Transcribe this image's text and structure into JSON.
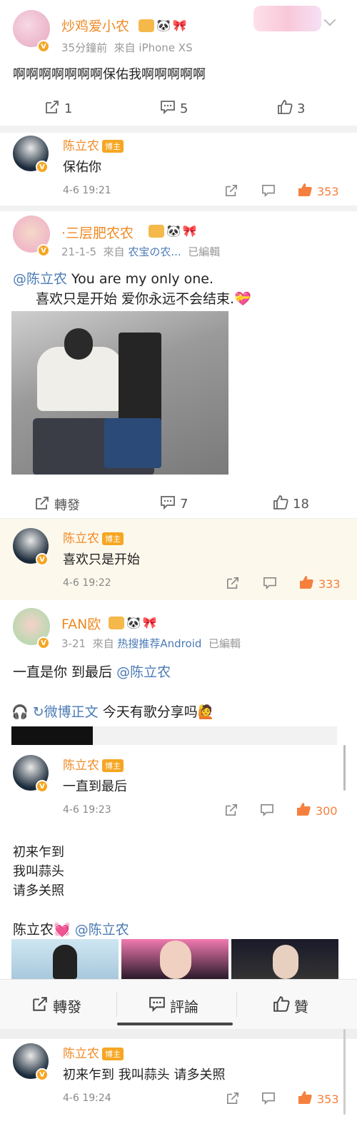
{
  "post1": {
    "username": "炒鸡爱小农",
    "time": "35分鐘前",
    "source": "來自 iPhone XS",
    "text": "啊啊啊啊啊啊啊保佑我啊啊啊啊啊",
    "repost_count": "1",
    "comment_count": "5",
    "like_count": "3"
  },
  "reply1": {
    "username": "陈立农",
    "badge": "博主",
    "text": "保佑你",
    "time": "4-6 19:21",
    "like_count": "353"
  },
  "post2": {
    "username": "·三层肥农农",
    "time": "21-1-5",
    "source_prefix": "來自",
    "source": "农宝の农...",
    "edited": "已編輯",
    "mention": "@陈立农",
    "text_line1": " You are my only one.",
    "text_line2": "喜欢只是开始 爱你永远不会结束.",
    "repost_label": "轉發",
    "comment_count": "7",
    "like_count": "18"
  },
  "reply2": {
    "username": "陈立农",
    "badge": "博主",
    "text": "喜欢只是开始",
    "time": "4-6 19:22",
    "like_count": "333"
  },
  "post3": {
    "username": "FAN欧",
    "time": "3-21",
    "source_prefix": "來自",
    "source": "热搜推荐Android",
    "edited": "已編輯",
    "text": "一直是你 到最后 ",
    "mention": "@陈立农",
    "music_link": "微博正文",
    "music_text": " 今天有歌分享吗"
  },
  "reply3": {
    "username": "陈立农",
    "badge": "博主",
    "text": "一直到最后",
    "time": "4-6 19:23",
    "like_count": "300"
  },
  "post4": {
    "line1": "初来乍到",
    "line2": "我叫蒜头",
    "line3": "请多关照",
    "name": "陈立农",
    "mention": "@陈立农"
  },
  "toolbar": {
    "repost": "轉發",
    "comment": "評論",
    "like": "贊"
  },
  "reply4": {
    "username": "陈立农",
    "badge": "博主",
    "text": "初来乍到 我叫蒜头 请多关照",
    "time": "4-6 19:24",
    "like_count": "353"
  },
  "colors": {
    "accent": "#f08a24",
    "link": "#4a7ab5",
    "like_active": "#f5803e"
  }
}
